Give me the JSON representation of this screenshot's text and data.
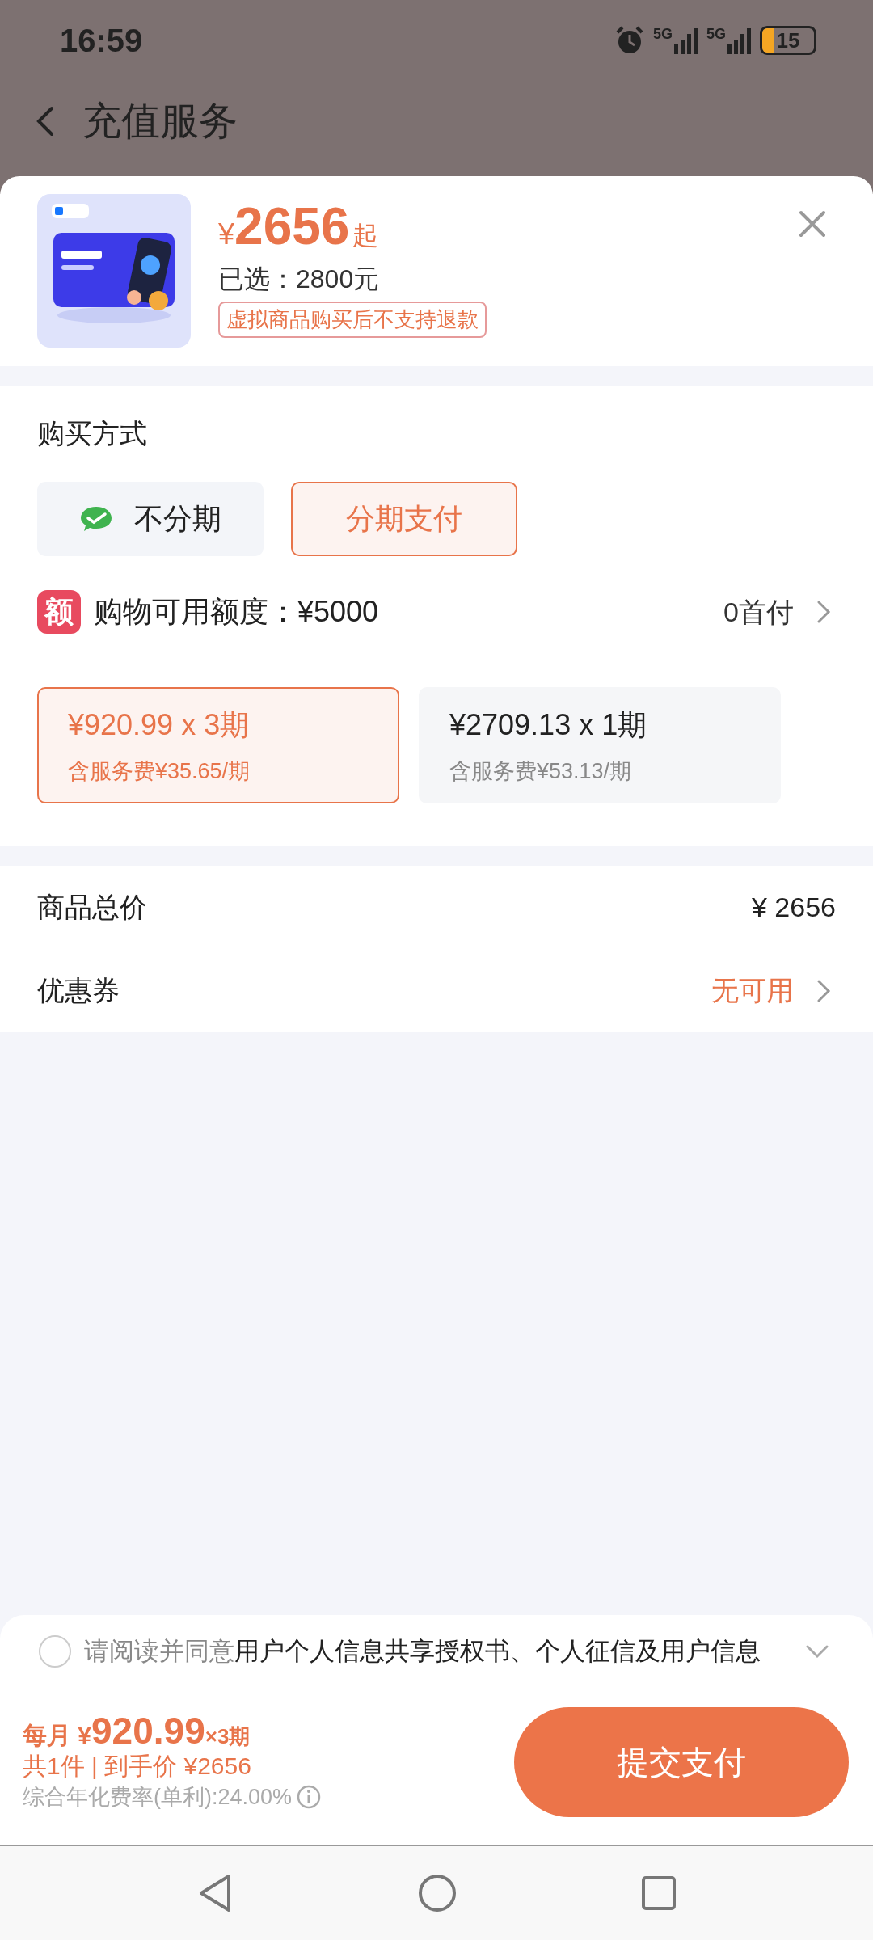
{
  "status_bar": {
    "time": "16:59",
    "network_1": "5G",
    "network_2": "5G",
    "battery": "15"
  },
  "header": {
    "title": "充值服务"
  },
  "product": {
    "currency": "¥",
    "price": "2656",
    "price_suffix": "起",
    "selected_option": "已选：2800元",
    "notice": "虚拟商品购买后不支持退款"
  },
  "purchase": {
    "title": "购买方式",
    "methods": [
      {
        "label": "不分期",
        "selected": false,
        "kind": "wallet"
      },
      {
        "label": "分期支付",
        "selected": true,
        "kind": "plain"
      }
    ],
    "credit": {
      "badge": "额",
      "label": "购物可用额度：¥5000",
      "link": "0首付"
    },
    "plans": [
      {
        "amount": "¥920.99 x 3期",
        "fee": "含服务费¥35.65/期",
        "selected": true
      },
      {
        "amount": "¥2709.13 x 1期",
        "fee": "含服务费¥53.13/期",
        "selected": false
      }
    ]
  },
  "totals": [
    {
      "label": "商品总价",
      "value": "¥ 2656",
      "kind": "plain"
    },
    {
      "label": "优惠券",
      "value": "无可用",
      "kind": "link"
    }
  ],
  "agreement": {
    "checked": false,
    "expanded": false,
    "prefix": "请阅读并同意",
    "link": "用户个人信息共享授权书、个人征信及用户信息"
  },
  "footer": {
    "monthly_label": "每月",
    "currency": "¥",
    "amount": "920.99",
    "periods": "×3期",
    "summary": "共1件 | 到手价 ¥2656",
    "rate": "综合年化费率(单利):24.00%",
    "submit": "提交支付"
  }
}
